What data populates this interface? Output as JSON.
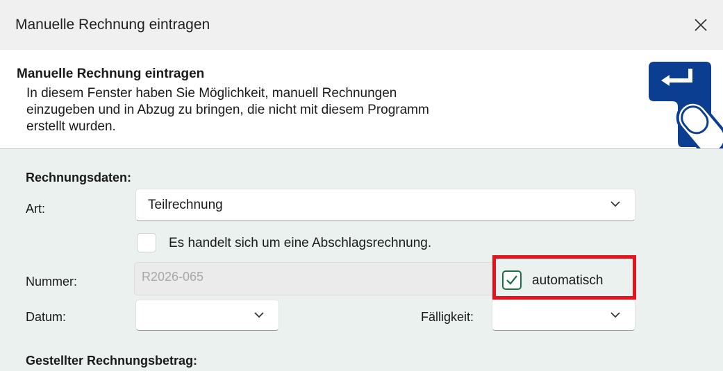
{
  "window": {
    "title": "Manuelle Rechnung eintragen",
    "close_icon": "close-icon"
  },
  "header": {
    "title": "Manuelle Rechnung eintragen",
    "description_line1": "In diesem Fenster haben Sie Möglichkeit, manuell Rechnungen",
    "description_line2": "einzugeben und in Abzug zu bringen, die nicht mit diesem Programm",
    "description_line3": "erstellt wurden.",
    "icon": "enter-key-touch-icon",
    "icon_color": "#0b3d91"
  },
  "form": {
    "section_invoice_data": "Rechnungsdaten:",
    "art_label": "Art:",
    "art_value": "Teilrechnung",
    "abschlag_checkbox_label": "Es handelt sich um eine Abschlagsrechnung.",
    "abschlag_checked": false,
    "nummer_label": "Nummer:",
    "nummer_value": "R2026-065",
    "automatisch_label": "automatisch",
    "automatisch_checked": true,
    "datum_label": "Datum:",
    "datum_value": "",
    "faelligkeit_label": "Fälligkeit:",
    "faelligkeit_value": "",
    "section_amount": "Gestellter Rechnungsbetrag:"
  },
  "colors": {
    "highlight": "#e3141e",
    "checkbox_accent": "#1f6b4a",
    "content_bg": "#eaf1ef"
  }
}
